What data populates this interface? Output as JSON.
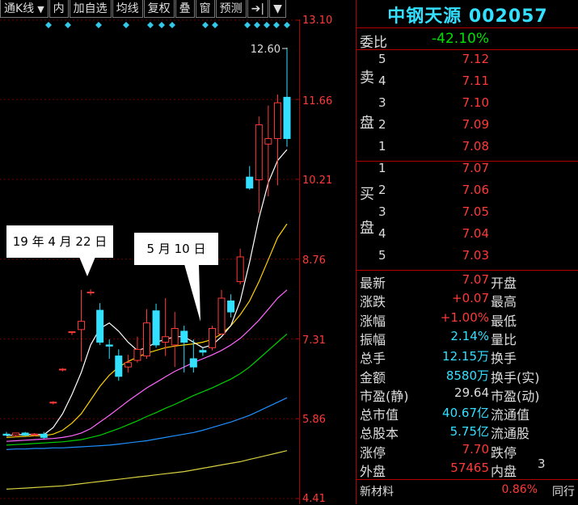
{
  "toolbar": {
    "items": [
      {
        "label": "通K线",
        "arrow": "▼"
      },
      {
        "label": "内"
      },
      {
        "label": "加自选"
      },
      {
        "label": "均线"
      },
      {
        "label": "复权"
      },
      {
        "label": "叠"
      },
      {
        "label": "窗"
      },
      {
        "label": "预测"
      },
      {
        "label": "➔|"
      },
      {
        "label": "▼"
      }
    ]
  },
  "price_axis": [
    "13.10",
    "11.66",
    "10.21",
    "8.76",
    "7.31",
    "5.86",
    "4.41"
  ],
  "chart_annotations": {
    "high_label": "12.60",
    "callout_1": "19 年 4 月 22 日",
    "callout_2": "5 月 10 日"
  },
  "chart_data": {
    "type": "candlestick",
    "ylim": [
      4.41,
      13.1
    ],
    "ticks": [
      13.1,
      11.66,
      10.21,
      8.76,
      7.31,
      5.86,
      4.41
    ],
    "colors": {
      "up": "#ff3a3a",
      "down": "#33e0ff",
      "ma5": "#ffffff",
      "ma10": "#ffd000",
      "ma20": "#ff66ff",
      "ma30": "#00d000",
      "ma60": "#1e90ff",
      "ma120": "#d8d040"
    },
    "candles": [
      {
        "o": 5.58,
        "h": 5.62,
        "l": 5.55,
        "c": 5.56
      },
      {
        "o": 5.56,
        "h": 5.6,
        "l": 5.53,
        "c": 5.6
      },
      {
        "o": 5.6,
        "h": 5.62,
        "l": 5.55,
        "c": 5.56
      },
      {
        "o": 5.57,
        "h": 5.6,
        "l": 5.54,
        "c": 5.58
      },
      {
        "o": 5.58,
        "h": 5.62,
        "l": 5.5,
        "c": 5.52
      },
      {
        "o": 6.15,
        "h": 6.18,
        "l": 6.12,
        "c": 6.16
      },
      {
        "o": 6.75,
        "h": 6.78,
        "l": 6.72,
        "c": 6.76
      },
      {
        "o": 7.43,
        "h": 7.45,
        "l": 7.38,
        "c": 7.44
      },
      {
        "o": 7.48,
        "h": 8.2,
        "l": 6.9,
        "c": 7.63
      },
      {
        "o": 8.16,
        "h": 8.21,
        "l": 8.1,
        "c": 8.16
      },
      {
        "o": 7.83,
        "h": 7.96,
        "l": 7.2,
        "c": 7.25
      },
      {
        "o": 7.2,
        "h": 7.3,
        "l": 6.95,
        "c": 7.18
      },
      {
        "o": 7.0,
        "h": 7.12,
        "l": 6.55,
        "c": 6.63
      },
      {
        "o": 6.8,
        "h": 7.02,
        "l": 6.7,
        "c": 6.88
      },
      {
        "o": 6.92,
        "h": 7.35,
        "l": 6.88,
        "c": 7.12
      },
      {
        "o": 7.0,
        "h": 7.85,
        "l": 6.95,
        "c": 7.6
      },
      {
        "o": 7.82,
        "h": 7.95,
        "l": 7.15,
        "c": 7.2
      },
      {
        "o": 7.25,
        "h": 8.05,
        "l": 7.0,
        "c": 7.35
      },
      {
        "o": 7.2,
        "h": 7.8,
        "l": 6.8,
        "c": 7.5
      },
      {
        "o": 7.45,
        "h": 7.55,
        "l": 6.7,
        "c": 7.25
      },
      {
        "o": 6.95,
        "h": 7.3,
        "l": 6.7,
        "c": 6.8
      },
      {
        "o": 7.1,
        "h": 7.15,
        "l": 7.0,
        "c": 7.07
      },
      {
        "o": 7.15,
        "h": 7.55,
        "l": 7.1,
        "c": 7.5
      },
      {
        "o": 7.4,
        "h": 8.2,
        "l": 7.4,
        "c": 8.05
      },
      {
        "o": 8.0,
        "h": 8.12,
        "l": 7.7,
        "c": 7.8
      },
      {
        "o": 8.35,
        "h": 8.95,
        "l": 8.3,
        "c": 8.8
      },
      {
        "o": 10.25,
        "h": 10.45,
        "l": 10.02,
        "c": 10.05
      },
      {
        "o": 10.2,
        "h": 11.35,
        "l": 9.6,
        "c": 11.2
      },
      {
        "o": 10.85,
        "h": 11.55,
        "l": 9.9,
        "c": 10.95
      },
      {
        "o": 10.95,
        "h": 11.75,
        "l": 10.1,
        "c": 11.6
      },
      {
        "o": 11.7,
        "h": 12.6,
        "l": 10.8,
        "c": 10.95
      }
    ],
    "ma": {
      "ma5": [
        5.55,
        5.57,
        5.57,
        5.58,
        5.57,
        5.7,
        5.95,
        6.3,
        6.7,
        7.2,
        7.5,
        7.6,
        7.45,
        7.25,
        7.1,
        7.15,
        7.25,
        7.3,
        7.35,
        7.35,
        7.25,
        7.15,
        7.2,
        7.35,
        7.55,
        8.0,
        8.7,
        9.5,
        10.15,
        10.55,
        10.75
      ],
      "ma10": [
        5.52,
        5.53,
        5.54,
        5.55,
        5.55,
        5.58,
        5.65,
        5.78,
        5.95,
        6.2,
        6.45,
        6.65,
        6.8,
        6.9,
        6.98,
        7.05,
        7.1,
        7.15,
        7.18,
        7.2,
        7.22,
        7.25,
        7.3,
        7.4,
        7.55,
        7.75,
        8.0,
        8.35,
        8.75,
        9.15,
        9.4
      ],
      "ma20": [
        5.45,
        5.46,
        5.47,
        5.48,
        5.49,
        5.5,
        5.52,
        5.55,
        5.6,
        5.68,
        5.8,
        5.92,
        6.05,
        6.18,
        6.3,
        6.42,
        6.52,
        6.62,
        6.72,
        6.8,
        6.88,
        6.95,
        7.02,
        7.1,
        7.2,
        7.32,
        7.48,
        7.65,
        7.85,
        8.05,
        8.2
      ],
      "ma30": [
        5.38,
        5.39,
        5.4,
        5.41,
        5.42,
        5.43,
        5.44,
        5.46,
        5.48,
        5.52,
        5.56,
        5.62,
        5.68,
        5.75,
        5.82,
        5.9,
        5.97,
        6.05,
        6.12,
        6.2,
        6.28,
        6.35,
        6.42,
        6.5,
        6.58,
        6.68,
        6.8,
        6.95,
        7.1,
        7.25,
        7.4
      ],
      "ma60": [
        5.3,
        5.31,
        5.31,
        5.32,
        5.32,
        5.33,
        5.33,
        5.34,
        5.35,
        5.36,
        5.37,
        5.38,
        5.4,
        5.42,
        5.44,
        5.46,
        5.49,
        5.52,
        5.55,
        5.58,
        5.61,
        5.65,
        5.7,
        5.75,
        5.8,
        5.86,
        5.92,
        6.0,
        6.08,
        6.16,
        6.24
      ],
      "ma120": [
        4.58,
        4.59,
        4.6,
        4.61,
        4.62,
        4.63,
        4.64,
        4.66,
        4.68,
        4.7,
        4.72,
        4.74,
        4.76,
        4.78,
        4.8,
        4.82,
        4.84,
        4.86,
        4.88,
        4.9,
        4.93,
        4.96,
        4.99,
        5.02,
        5.05,
        5.08,
        5.12,
        5.16,
        5.2,
        5.24,
        5.28
      ]
    }
  },
  "right_panel": {
    "title": "中钢天源 002057",
    "weibi_label": "委比",
    "weibi_value": "-42.10%",
    "sell_label_1": "卖",
    "sell_label_2": "盘",
    "buy_label_1": "买",
    "buy_label_2": "盘",
    "sell": [
      {
        "level": "5",
        "price": "7.12"
      },
      {
        "level": "4",
        "price": "7.11"
      },
      {
        "level": "3",
        "price": "7.10"
      },
      {
        "level": "2",
        "price": "7.09"
      },
      {
        "level": "1",
        "price": "7.08"
      }
    ],
    "buy": [
      {
        "level": "1",
        "price": "7.07"
      },
      {
        "level": "2",
        "price": "7.06"
      },
      {
        "level": "3",
        "price": "7.05"
      },
      {
        "level": "4",
        "price": "7.04"
      },
      {
        "level": "5",
        "price": "7.03"
      }
    ],
    "stats": [
      {
        "label": "最新",
        "value": "7.07",
        "color": "red",
        "label2": "开盘"
      },
      {
        "label": "涨跌",
        "value": "+0.07",
        "color": "red",
        "label2": "最高"
      },
      {
        "label": "涨幅",
        "value": "+1.00%",
        "color": "red",
        "label2": "最低"
      },
      {
        "label": "振幅",
        "value": "2.14%",
        "color": "cyan",
        "label2": "量比"
      },
      {
        "label": "总手",
        "value": "12.15万",
        "color": "cyan",
        "label2": "换手"
      },
      {
        "label": "金额",
        "value": "8580万",
        "color": "cyan",
        "label2": "换手(实)"
      },
      {
        "label": "市盈(静)",
        "value": "29.64",
        "color": "white",
        "label2": "市盈(动)"
      },
      {
        "label": "总市值",
        "value": "40.67亿",
        "color": "cyan",
        "label2": "流通值"
      },
      {
        "label": "总股本",
        "value": "5.75亿",
        "color": "cyan",
        "label2": "流通股"
      },
      {
        "label": "涨停",
        "value": "7.70",
        "color": "red",
        "label2": "跌停"
      },
      {
        "label": "外盘",
        "value": "57465",
        "color": "red",
        "label2": "内盘"
      }
    ],
    "partial_right": {
      "liutongzhi": "3",
      "liutonggu": "."
    },
    "footer": {
      "sector": "新材料",
      "pct": "0.86%",
      "tail": "同行"
    }
  }
}
